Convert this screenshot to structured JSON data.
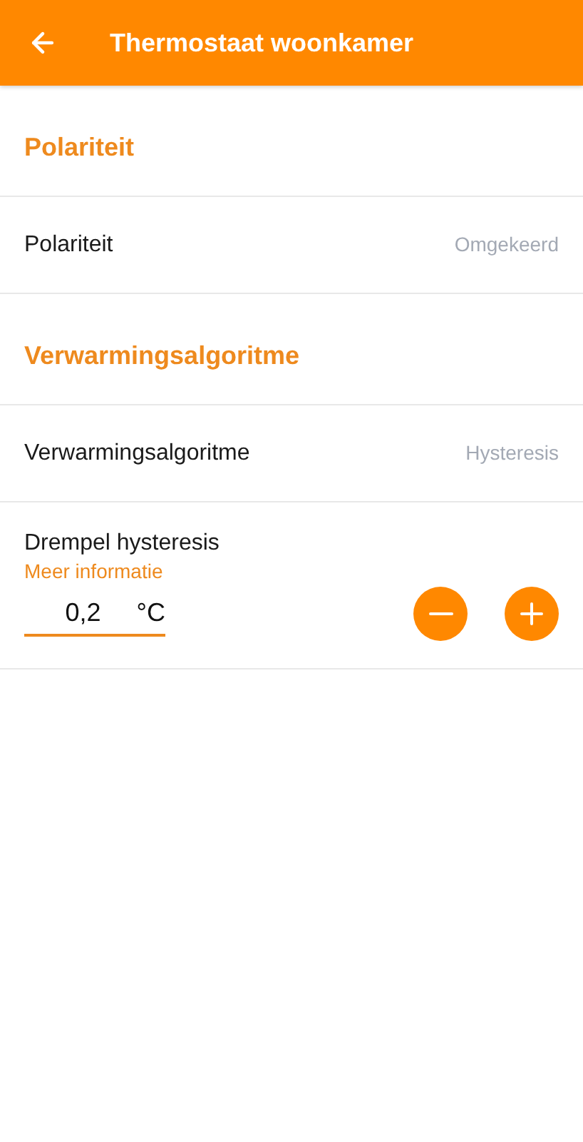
{
  "header": {
    "title": "Thermostaat woonkamer"
  },
  "items": [
    {
      "kind": "heading",
      "label": "Polariteit"
    },
    {
      "kind": "setting",
      "label": "Polariteit",
      "value": "Omgekeerd"
    },
    {
      "kind": "heading",
      "label": "Verwarmingsalgoritme"
    },
    {
      "kind": "setting",
      "label": "Verwarmingsalgoritme",
      "value": "Hysteresis"
    },
    {
      "kind": "stepper",
      "label": "Drempel hysteresis",
      "link": "Meer informatie",
      "value": "0,2",
      "unit": "°C"
    }
  ]
}
